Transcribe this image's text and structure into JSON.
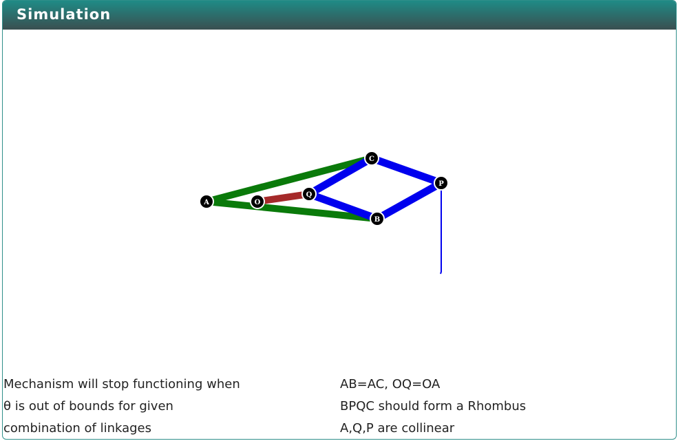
{
  "header": {
    "title": "Simulation"
  },
  "mechanism": {
    "joint_labels": {
      "A": "A",
      "O": "O",
      "Q": "Q",
      "C": "C",
      "B": "B",
      "P": "P"
    },
    "colors": {
      "fixed_links": "#0a7a0a",
      "crank": "#a52a2a",
      "rhombus": "#0000ee",
      "trace": "#0000ee",
      "joint_fill": "#000000",
      "joint_text": "#ffffff"
    }
  },
  "notes": {
    "left": [
      "Mechanism will stop functioning when",
      "θ is out of bounds for given",
      "combination of linkages"
    ],
    "right": [
      "AB=AC, OQ=OA",
      "BPQC should form a Rhombus",
      "A,Q,P are collinear"
    ]
  }
}
